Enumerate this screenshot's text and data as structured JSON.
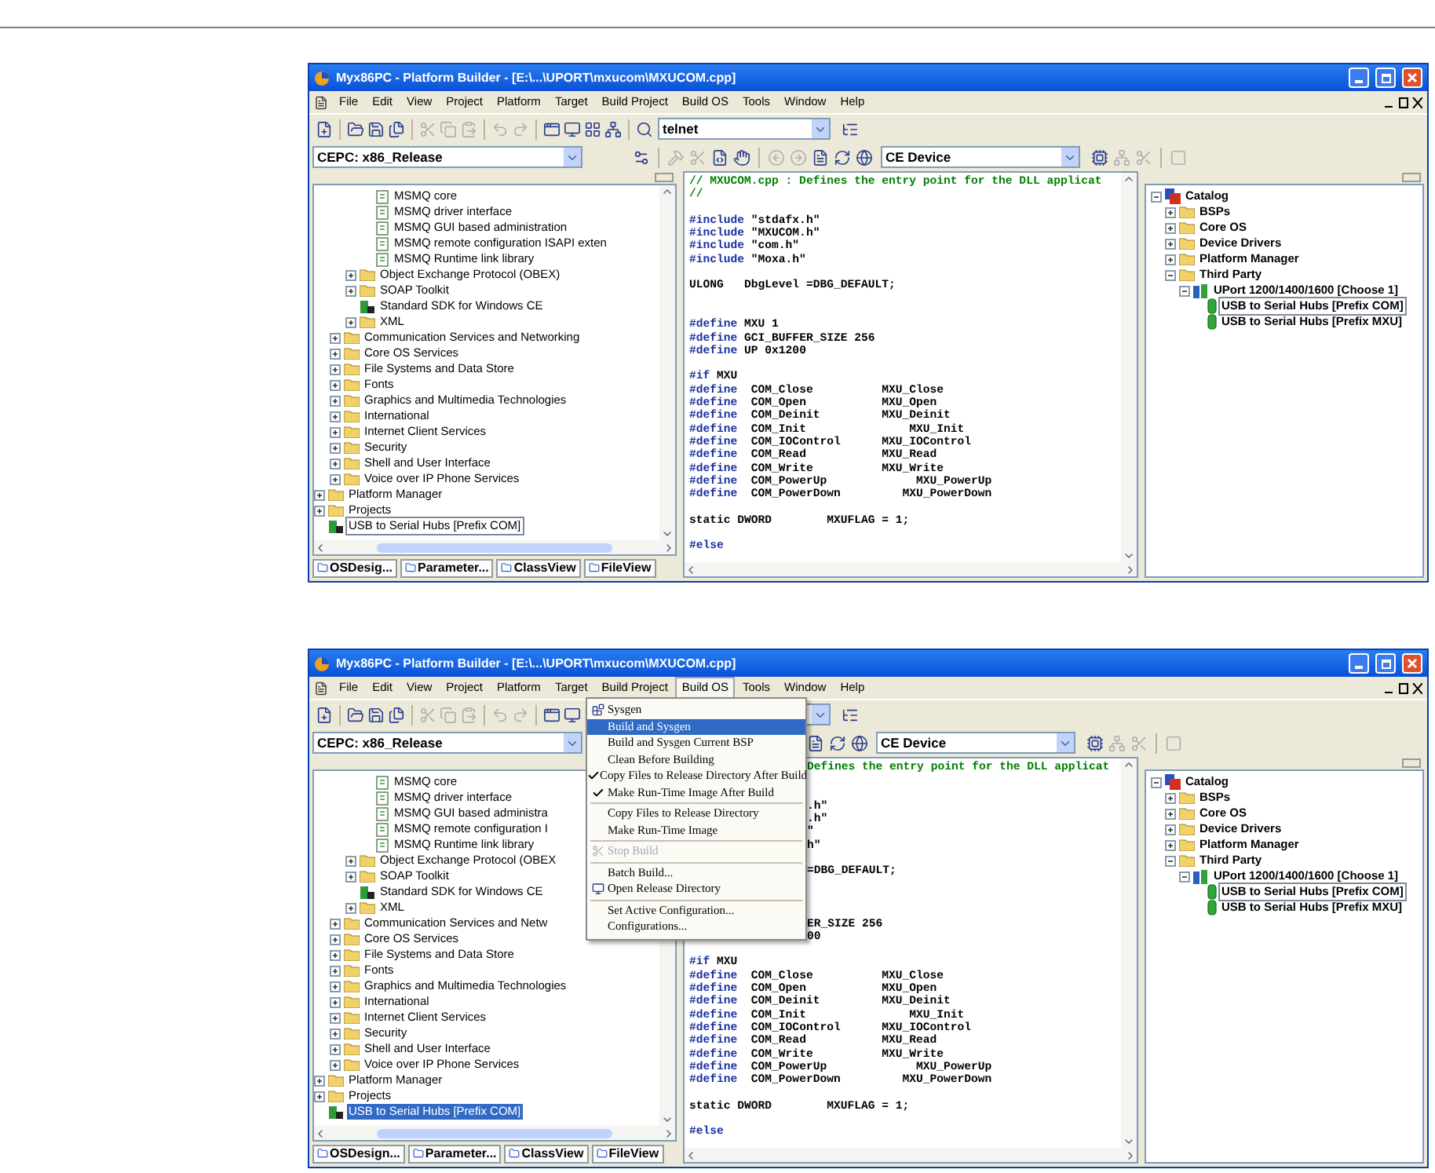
{
  "windows": [
    {
      "title": "Myx86PC - Platform Builder - [E:\\...\\UPORT\\mxucom\\MXUCOM.cpp]",
      "menus": [
        {
          "label": "File",
          "selected": false
        },
        {
          "label": "Edit",
          "selected": false
        },
        {
          "label": "View",
          "selected": false
        },
        {
          "label": "Project",
          "selected": false
        },
        {
          "label": "Platform",
          "selected": false
        },
        {
          "label": "Target",
          "selected": false
        },
        {
          "label": "Build Project",
          "selected": false
        },
        {
          "label": "Build OS",
          "selected": false
        },
        {
          "label": "Tools",
          "selected": false
        },
        {
          "label": "Window",
          "selected": false
        },
        {
          "label": "Help",
          "selected": false
        }
      ],
      "find_combo": {
        "value": "telnet"
      },
      "config_combo": {
        "value": "CEPC: x86_Release"
      },
      "device_combo": {
        "value": "CE Device"
      },
      "tree_focused": false,
      "tree": [
        {
          "children": [
            {
              "children": [
                {
                  "children": [
                    {
                      "label": "MSMQ core",
                      "kind": "component",
                      "selected": false
                    },
                    {
                      "label": "MSMQ driver interface",
                      "kind": "component",
                      "selected": false
                    },
                    {
                      "label": "MSMQ GUI based administration",
                      "kind": "component",
                      "selected": false
                    },
                    {
                      "label": "MSMQ remote configuration ISAPI exten",
                      "kind": "component",
                      "selected": false
                    },
                    {
                      "label": "MSMQ Runtime link library",
                      "kind": "component",
                      "selected": false
                    }
                  ]
                },
                {
                  "label": "Object Exchange Protocol (OBEX)",
                  "kind": "folder",
                  "expanded": false,
                  "selected": false
                },
                {
                  "label": "SOAP Toolkit",
                  "kind": "folder",
                  "expanded": false,
                  "selected": false
                },
                {
                  "label": "Standard SDK for Windows CE",
                  "kind": "sdk",
                  "selected": false
                },
                {
                  "label": "XML",
                  "kind": "folder",
                  "expanded": false,
                  "selected": false
                }
              ]
            },
            {
              "label": "Communication Services and Networking",
              "kind": "folder",
              "expanded": false,
              "selected": false
            },
            {
              "label": "Core OS Services",
              "kind": "folder",
              "expanded": false,
              "selected": false
            },
            {
              "label": "File Systems and Data Store",
              "kind": "folder",
              "expanded": false,
              "selected": false
            },
            {
              "label": "Fonts",
              "kind": "folder",
              "expanded": false,
              "selected": false
            },
            {
              "label": "Graphics and Multimedia Technologies",
              "kind": "folder",
              "expanded": false,
              "selected": false
            },
            {
              "label": "International",
              "kind": "folder",
              "expanded": false,
              "selected": false
            },
            {
              "label": "Internet Client Services",
              "kind": "folder",
              "expanded": false,
              "selected": false
            },
            {
              "label": "Security",
              "kind": "folder",
              "expanded": false,
              "selected": false
            },
            {
              "label": "Shell and User Interface",
              "kind": "folder",
              "expanded": false,
              "selected": false
            },
            {
              "label": "Voice over IP Phone Services",
              "kind": "folder",
              "expanded": false,
              "selected": false
            }
          ]
        },
        {
          "label": "Platform Manager",
          "kind": "folder",
          "expanded": false,
          "selected": false
        },
        {
          "label": "Projects",
          "kind": "folder",
          "expanded": false,
          "selected": false
        },
        {
          "label": "USB to Serial Hubs [Prefix COM]",
          "kind": "sdk",
          "selected": true
        }
      ],
      "tabs": [
        "OSDesig...",
        "Parameter...",
        "ClassView",
        "FileView"
      ],
      "code": [
        {
          "kind": "comment",
          "text": "// MXUCOM.cpp : Defines the entry point for the DLL applicat"
        },
        {
          "kind": "comment",
          "text": "//"
        },
        {
          "kind": "blank"
        },
        {
          "kind": "directive",
          "keyword": "#include",
          "text": " \"stdafx.h\""
        },
        {
          "kind": "directive",
          "keyword": "#include",
          "text": " \"MXUCOM.h\""
        },
        {
          "kind": "directive",
          "keyword": "#include",
          "text": " \"com.h\""
        },
        {
          "kind": "directive",
          "keyword": "#include",
          "text": " \"Moxa.h\""
        },
        {
          "kind": "blank"
        },
        {
          "kind": "plain",
          "text": "ULONG   DbgLevel =DBG_DEFAULT;"
        },
        {
          "kind": "blank"
        },
        {
          "kind": "blank"
        },
        {
          "kind": "directive",
          "keyword": "#define",
          "text": " MXU 1"
        },
        {
          "kind": "directive",
          "keyword": "#define",
          "text": " GCI_BUFFER_SIZE 256"
        },
        {
          "kind": "directive",
          "keyword": "#define",
          "text": " UP 0x1200"
        },
        {
          "kind": "blank"
        },
        {
          "kind": "directive",
          "keyword": "#if",
          "text": " MXU"
        },
        {
          "kind": "directive",
          "keyword": "#define",
          "text": "  COM_Close          MXU_Close"
        },
        {
          "kind": "directive",
          "keyword": "#define",
          "text": "  COM_Open           MXU_Open"
        },
        {
          "kind": "directive",
          "keyword": "#define",
          "text": "  COM_Deinit         MXU_Deinit"
        },
        {
          "kind": "directive",
          "keyword": "#define",
          "text": "  COM_Init               MXU_Init"
        },
        {
          "kind": "directive",
          "keyword": "#define",
          "text": "  COM_IOControl      MXU_IOControl"
        },
        {
          "kind": "directive",
          "keyword": "#define",
          "text": "  COM_Read           MXU_Read"
        },
        {
          "kind": "directive",
          "keyword": "#define",
          "text": "  COM_Write          MXU_Write"
        },
        {
          "kind": "directive",
          "keyword": "#define",
          "text": "  COM_PowerUp             MXU_PowerUp"
        },
        {
          "kind": "directive",
          "keyword": "#define",
          "text": "  COM_PowerDown         MXU_PowerDown"
        },
        {
          "kind": "blank"
        },
        {
          "kind": "plain",
          "text": "static DWORD        MXUFLAG = 1;"
        },
        {
          "kind": "blank"
        },
        {
          "kind": "directive",
          "keyword": "#else"
        }
      ],
      "catalog": [
        {
          "label": "Catalog",
          "kind": "catalog",
          "expanded": true,
          "selected": false,
          "children": [
            {
              "label": "BSPs",
              "kind": "folder",
              "expanded": false,
              "selected": false
            },
            {
              "label": "Core OS",
              "kind": "folder",
              "expanded": false,
              "selected": false
            },
            {
              "label": "Device Drivers",
              "kind": "folder",
              "expanded": false,
              "selected": false
            },
            {
              "label": "Platform Manager",
              "kind": "folder",
              "expanded": false,
              "selected": false
            },
            {
              "label": "Third Party",
              "kind": "folder",
              "expanded": true,
              "selected": false,
              "children": [
                {
                  "label": "UPort 1200/1400/1600 [Choose 1]",
                  "kind": "package",
                  "expanded": true,
                  "selected": false,
                  "children": [
                    {
                      "label": "USB to Serial Hubs [Prefix COM]",
                      "kind": "item",
                      "selected": true
                    },
                    {
                      "label": "USB to Serial Hubs [Prefix MXU]",
                      "kind": "item",
                      "selected": false
                    }
                  ]
                }
              ]
            }
          ]
        }
      ]
    },
    {
      "title": "Myx86PC - Platform Builder - [E:\\...\\UPORT\\mxucom\\MXUCOM.cpp]",
      "menus": [
        {
          "label": "File",
          "selected": false
        },
        {
          "label": "Edit",
          "selected": false
        },
        {
          "label": "View",
          "selected": false
        },
        {
          "label": "Project",
          "selected": false
        },
        {
          "label": "Platform",
          "selected": false
        },
        {
          "label": "Target",
          "selected": false
        },
        {
          "label": "Build Project",
          "selected": false
        },
        {
          "label": "Build OS",
          "selected": true
        },
        {
          "label": "Tools",
          "selected": false
        },
        {
          "label": "Window",
          "selected": false
        },
        {
          "label": "Help",
          "selected": false
        }
      ],
      "config_combo": {
        "value": "CEPC: x86_Release"
      },
      "device_combo": {
        "value": "CE Device"
      },
      "tree_focused": true,
      "tree": [
        {
          "children": [
            {
              "children": [
                {
                  "children": [
                    {
                      "label": "MSMQ core",
                      "kind": "component",
                      "selected": false
                    },
                    {
                      "label": "MSMQ driver interface",
                      "kind": "component",
                      "selected": false
                    },
                    {
                      "label": "MSMQ GUI based administra",
                      "kind": "component",
                      "selected": false
                    },
                    {
                      "label": "MSMQ remote configuration I",
                      "kind": "component",
                      "selected": false
                    },
                    {
                      "label": "MSMQ Runtime link library",
                      "kind": "component",
                      "selected": false
                    }
                  ]
                },
                {
                  "label": "Object Exchange Protocol (OBEX",
                  "kind": "folder",
                  "expanded": false,
                  "selected": false
                },
                {
                  "label": "SOAP Toolkit",
                  "kind": "folder",
                  "expanded": false,
                  "selected": false
                },
                {
                  "label": "Standard SDK for Windows CE",
                  "kind": "sdk",
                  "selected": false
                },
                {
                  "label": "XML",
                  "kind": "folder",
                  "expanded": false,
                  "selected": false
                }
              ]
            },
            {
              "label": "Communication Services and Netw",
              "kind": "folder",
              "expanded": false,
              "selected": false
            },
            {
              "label": "Core OS Services",
              "kind": "folder",
              "expanded": false,
              "selected": false
            },
            {
              "label": "File Systems and Data Store",
              "kind": "folder",
              "expanded": false,
              "selected": false
            },
            {
              "label": "Fonts",
              "kind": "folder",
              "expanded": false,
              "selected": false
            },
            {
              "label": "Graphics and Multimedia Technologies",
              "kind": "folder",
              "expanded": false,
              "selected": false
            },
            {
              "label": "International",
              "kind": "folder",
              "expanded": false,
              "selected": false
            },
            {
              "label": "Internet Client Services",
              "kind": "folder",
              "expanded": false,
              "selected": false
            },
            {
              "label": "Security",
              "kind": "folder",
              "expanded": false,
              "selected": false
            },
            {
              "label": "Shell and User Interface",
              "kind": "folder",
              "expanded": false,
              "selected": false
            },
            {
              "label": "Voice over IP Phone Services",
              "kind": "folder",
              "expanded": false,
              "selected": false
            }
          ]
        },
        {
          "label": "Platform Manager",
          "kind": "folder",
          "expanded": false,
          "selected": false
        },
        {
          "label": "Projects",
          "kind": "folder",
          "expanded": false,
          "selected": false
        },
        {
          "label": "USB to Serial Hubs [Prefix COM]",
          "kind": "sdk",
          "selected": true
        }
      ],
      "tabs": [
        "OSDesign...",
        "Parameter...",
        "ClassView",
        "FileView"
      ],
      "code": [
        {
          "kind": "comment",
          "text": "Defines the entry point for the DLL applicat",
          "clipped": true
        },
        {
          "kind": "blank"
        },
        {
          "kind": "blank"
        },
        {
          "kind": "plain",
          "text": ".h\"",
          "clipped": true
        },
        {
          "kind": "plain",
          "text": ".h\"",
          "clipped": true
        },
        {
          "kind": "plain",
          "text": "\"",
          "clipped": true
        },
        {
          "kind": "plain",
          "text": "h\"",
          "clipped": true
        },
        {
          "kind": "blank"
        },
        {
          "kind": "plain",
          "text": "=DBG_DEFAULT;",
          "clipped": true
        },
        {
          "kind": "blank"
        },
        {
          "kind": "blank"
        },
        {
          "kind": "blank"
        },
        {
          "kind": "plain",
          "text": "ER_SIZE 256",
          "clipped": true
        },
        {
          "kind": "plain",
          "text": "00",
          "clipped": true
        },
        {
          "kind": "blank"
        },
        {
          "kind": "directive",
          "keyword": "#if",
          "text": " MXU"
        },
        {
          "kind": "directive",
          "keyword": "#define",
          "text": "  COM_Close          MXU_Close"
        },
        {
          "kind": "directive",
          "keyword": "#define",
          "text": "  COM_Open           MXU_Open"
        },
        {
          "kind": "directive",
          "keyword": "#define",
          "text": "  COM_Deinit         MXU_Deinit"
        },
        {
          "kind": "directive",
          "keyword": "#define",
          "text": "  COM_Init               MXU_Init"
        },
        {
          "kind": "directive",
          "keyword": "#define",
          "text": "  COM_IOControl      MXU_IOControl"
        },
        {
          "kind": "directive",
          "keyword": "#define",
          "text": "  COM_Read           MXU_Read"
        },
        {
          "kind": "directive",
          "keyword": "#define",
          "text": "  COM_Write          MXU_Write"
        },
        {
          "kind": "directive",
          "keyword": "#define",
          "text": "  COM_PowerUp             MXU_PowerUp"
        },
        {
          "kind": "directive",
          "keyword": "#define",
          "text": "  COM_PowerDown         MXU_PowerDown"
        },
        {
          "kind": "blank"
        },
        {
          "kind": "plain",
          "text": "static DWORD        MXUFLAG = 1;"
        },
        {
          "kind": "blank"
        },
        {
          "kind": "directive",
          "keyword": "#else"
        }
      ],
      "catalog": [
        {
          "label": "Catalog",
          "kind": "catalog",
          "expanded": true,
          "selected": false,
          "children": [
            {
              "label": "BSPs",
              "kind": "folder",
              "expanded": false,
              "selected": false
            },
            {
              "label": "Core OS",
              "kind": "folder",
              "expanded": false,
              "selected": false
            },
            {
              "label": "Device Drivers",
              "kind": "folder",
              "expanded": false,
              "selected": false
            },
            {
              "label": "Platform Manager",
              "kind": "folder",
              "expanded": false,
              "selected": false
            },
            {
              "label": "Third Party",
              "kind": "folder",
              "expanded": true,
              "selected": false,
              "children": [
                {
                  "label": "UPort 1200/1400/1600 [Choose 1]",
                  "kind": "package",
                  "expanded": true,
                  "selected": false,
                  "children": [
                    {
                      "label": "USB to Serial Hubs [Prefix COM]",
                      "kind": "item",
                      "selected": true
                    },
                    {
                      "label": "USB to Serial Hubs [Prefix MXU]",
                      "kind": "item",
                      "selected": false
                    }
                  ]
                }
              ]
            }
          ]
        }
      ],
      "popup": [
        {
          "kind": "item",
          "label": "Sysgen",
          "selected": false,
          "checked": false,
          "disabled": false
        },
        {
          "kind": "item",
          "label": "Build and Sysgen",
          "selected": true,
          "checked": false,
          "disabled": false
        },
        {
          "kind": "item",
          "label": "Build and Sysgen Current BSP",
          "selected": false,
          "checked": false,
          "disabled": false
        },
        {
          "kind": "item",
          "label": "Clean Before Building",
          "selected": false,
          "checked": false,
          "disabled": false
        },
        {
          "kind": "item",
          "label": "Copy Files to Release Directory After Build",
          "selected": false,
          "checked": true,
          "disabled": false
        },
        {
          "kind": "item",
          "label": "Make Run-Time Image After Build",
          "selected": false,
          "checked": true,
          "disabled": false
        },
        {
          "kind": "separator"
        },
        {
          "kind": "item",
          "label": "Copy Files to Release Directory",
          "selected": false,
          "checked": false,
          "disabled": false
        },
        {
          "kind": "item",
          "label": "Make Run-Time Image",
          "selected": false,
          "checked": false,
          "disabled": false
        },
        {
          "kind": "separator"
        },
        {
          "kind": "item",
          "label": "Stop Build",
          "selected": false,
          "checked": false,
          "disabled": true
        },
        {
          "kind": "separator"
        },
        {
          "kind": "item",
          "label": "Batch Build...",
          "selected": false,
          "checked": false,
          "disabled": false
        },
        {
          "kind": "item",
          "label": "Open Release Directory",
          "selected": false,
          "checked": false,
          "disabled": false
        },
        {
          "kind": "separator"
        },
        {
          "kind": "item",
          "label": "Set Active Configuration...",
          "selected": false,
          "checked": false,
          "disabled": false
        },
        {
          "kind": "item",
          "label": "Configurations...",
          "selected": false,
          "checked": false,
          "disabled": false
        }
      ]
    }
  ]
}
